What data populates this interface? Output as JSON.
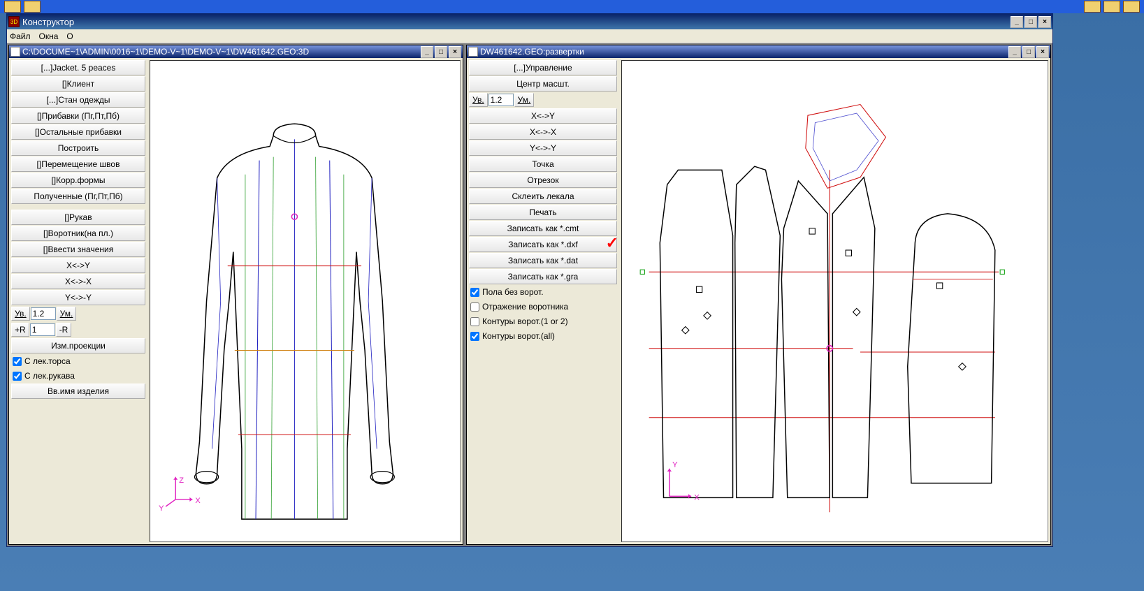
{
  "app": {
    "title": "Конструктор",
    "menu": {
      "file": "Файл",
      "windows": "Окна",
      "about": "О"
    }
  },
  "left_window": {
    "title": "C:\\DOCUME~1\\ADMIN\\0016~1\\DEMO-V~1\\DEMO-V~1\\DW461642.GEO:3D",
    "panel": {
      "btn_jacket": "[...]Jacket. 5 peaces",
      "btn_client": "[]Клиент",
      "btn_garment": "[...]Стан одежды",
      "btn_allowances": "[]Прибавки (Пг,Пт,Пб)",
      "btn_other_allow": "[]Остальные прибавки",
      "btn_build": "Построить",
      "btn_move_seams": "[]Перемещение швов",
      "btn_corr": "[]Корр.формы",
      "btn_obtained": "Полученные (Пг,Пт,Пб)",
      "btn_sleeve": "[]Рукав",
      "btn_collar": "[]Воротник(на пл.)",
      "btn_enter_values": "[]Ввести значения",
      "btn_xy": "X<->Y",
      "btn_xx": "X<->-X",
      "btn_yy": "Y<->-Y",
      "zoom_in": "Ув.",
      "zoom_val": "1.2",
      "zoom_out": "Ум.",
      "plus_r": "+R",
      "r_val": "1",
      "minus_r": "-R",
      "btn_change_proj": "Изм.проекции",
      "check_torso": "С лек.торса",
      "check_sleeve": "С лек.рукава",
      "btn_enter_name": "Вв.имя изделия"
    }
  },
  "right_window": {
    "title": "DW461642.GEO:развертки",
    "panel": {
      "btn_manage": "[...]Управление",
      "btn_center": "Центр масшт.",
      "zoom_in": "Ув.",
      "zoom_val": "1.2",
      "zoom_out": "Ум.",
      "btn_xy": "X<->Y",
      "btn_xx": "X<->-X",
      "btn_yy": "Y<->-Y",
      "btn_point": "Точка",
      "btn_segment": "Отрезок",
      "btn_merge": "Склеить лекала",
      "btn_print": "Печать",
      "btn_save_cmt": "Записать как *.cmt",
      "btn_save_dxf": "Записать как *.dxf",
      "btn_save_dat": "Записать как *.dat",
      "btn_save_gra": "Записать как *.gra",
      "check_no_collar": "Пола без ворот.",
      "check_collar_reflect": "Отражение воротника",
      "check_collar_1or2": "Контуры ворот.(1 or 2)",
      "check_collar_all": "Контуры ворот.(all)"
    }
  },
  "axis": {
    "x": "X",
    "y": "Y",
    "z": "Z"
  }
}
